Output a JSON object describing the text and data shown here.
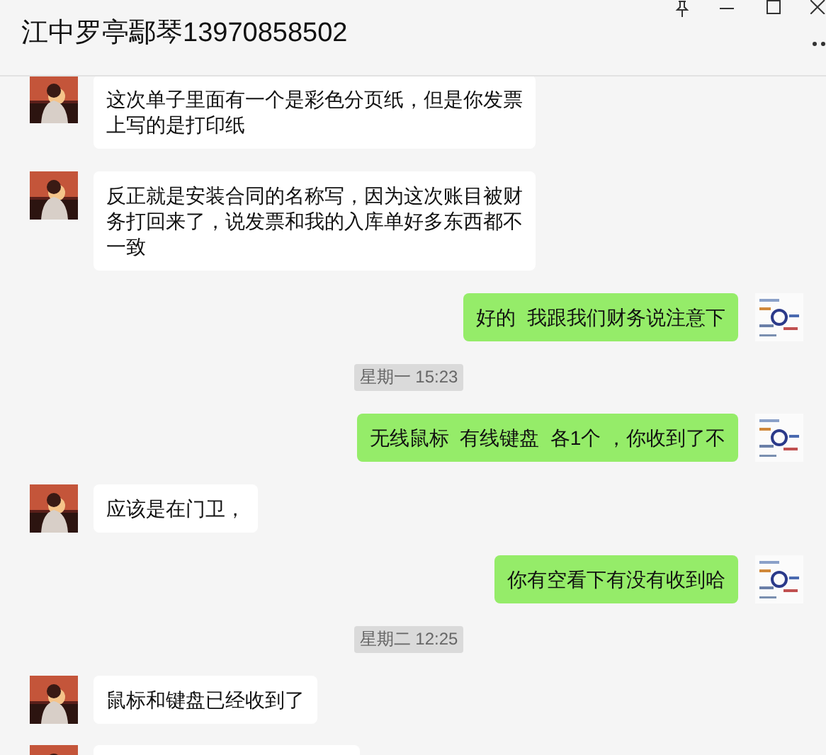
{
  "window": {
    "title": "江中罗亭鄢琴13970858502"
  },
  "messages": [
    {
      "kind": "in",
      "text": "这次单子里面有一个是彩色分页纸，但是你发票上写的是打印纸"
    },
    {
      "kind": "in",
      "text": "反正就是安装合同的名称写，因为这次账目被财务打回来了，说发票和我的入库单好多东西都不一致"
    },
    {
      "kind": "out",
      "text": "好的  我跟我们财务说注意下"
    },
    {
      "kind": "time",
      "text": "星期一 15:23"
    },
    {
      "kind": "out",
      "text": "无线鼠标  有线键盘  各1个 ，你收到了不"
    },
    {
      "kind": "in",
      "text": "应该是在门卫，"
    },
    {
      "kind": "out",
      "text": "你有空看下有没有收到哈"
    },
    {
      "kind": "time",
      "text": "星期二 12:25"
    },
    {
      "kind": "in",
      "text": "鼠标和键盘已经收到了"
    },
    {
      "kind": "in_cut"
    }
  ]
}
